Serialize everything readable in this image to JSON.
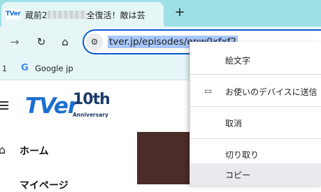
{
  "tab": {
    "favicon_text": "TVer",
    "title_start": "蔵前2",
    "title_end": "全復活！敵は芸"
  },
  "toolbar": {
    "url": "tver.jp/episodes/epw0xfxf2"
  },
  "bookmarks": {
    "partial": "1",
    "google_label": "Google jp"
  },
  "page": {
    "logo": "TVer",
    "anniversary_num": "10th",
    "anniversary_label": "Anniversary",
    "nav_home": "ホーム",
    "nav_next": "マイページ"
  },
  "context_menu": {
    "items": [
      {
        "label": "絵文字"
      },
      {
        "label": "お使いのデバイスに送信"
      },
      {
        "label": "取消"
      },
      {
        "label": "切り取り"
      },
      {
        "label": "コピー"
      }
    ]
  },
  "colors": {
    "tabstrip_bg": "#9fe0e7",
    "toolbar_bg": "#e6f6f7",
    "url_highlight": "#a8c7fa",
    "focus_ring": "#0b57d0"
  }
}
